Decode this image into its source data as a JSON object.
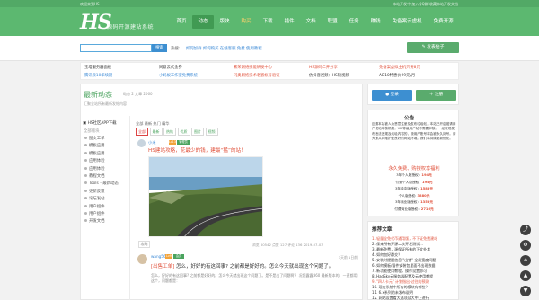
{
  "topbar": {
    "left": "欢迎来到HS",
    "right": "本站开发中 加入QQ群 收藏本站开发文档"
  },
  "header": {
    "logo": "HS",
    "logo_sub": "源码开源建站系统",
    "nav": [
      {
        "label": "首页",
        "active": false,
        "hot": false
      },
      {
        "label": "动态",
        "active": true,
        "hot": false
      },
      {
        "label": "版块",
        "active": false,
        "hot": false
      },
      {
        "label": "购买",
        "active": false,
        "hot": true
      },
      {
        "label": "下载",
        "active": false,
        "hot": false
      },
      {
        "label": "插件",
        "active": false,
        "hot": false
      },
      {
        "label": "文档",
        "active": false,
        "hot": false
      },
      {
        "label": "联盟",
        "active": false,
        "hot": false
      },
      {
        "label": "任务",
        "active": false,
        "hot": false
      },
      {
        "label": "赚钱",
        "active": false,
        "hot": false
      },
      {
        "label": "免备案云虚机",
        "active": false,
        "hot": false
      },
      {
        "label": "免费开源",
        "active": false,
        "hot": false
      }
    ]
  },
  "search": {
    "placeholder": "",
    "button": "搜索",
    "hot_label": "热搜:",
    "hot_links": "如何加群 如何购买 在线客服 免费 使用教程"
  },
  "post_button": "发表帖子",
  "adlinks": [
    {
      "text": "宝塔服务器面板",
      "color": "#333333"
    },
    {
      "text": "同意云代金券",
      "color": "#333333"
    },
    {
      "text": "繁荣网络技能研发中心",
      "color": "#e0523c"
    },
    {
      "text": "HS源码二开分享",
      "color": "#e0523c"
    },
    {
      "text": "免备案虚拟主机只要8元",
      "color": "#e0523c"
    },
    {
      "text": "腾讯云10年续期",
      "color": "#3c8ad6"
    },
    {
      "text": "小蚂蚁工作室免费系统",
      "color": "#3c8ad6"
    },
    {
      "text": "闪奥网络技术老板帐号验证",
      "color": "#e0523c"
    },
    {
      "text": "仿抖音视频：HS短视频",
      "color": "#333333"
    },
    {
      "text": "AD10特惠价99元/月",
      "color": "#333333"
    }
  ],
  "main": {
    "title": "最新动态",
    "meta": "动态 2   文章 2060",
    "desc": "汇聚全站所有最新发帖内容",
    "app_download": "HS社区APP下载",
    "menu_head": "全部版块",
    "menu": [
      "图文工单",
      "模板应用",
      "模板应用",
      "应用体验",
      "应用体验",
      "教程文档",
      "Tools - 最新动态",
      "更新反馈",
      "论坛发帖",
      "用户组件",
      "用户组件",
      "开发文档"
    ],
    "sort": "全部   最新   热门   精华",
    "tabs": [
      "全部",
      "最新",
      "热帖",
      "优质",
      "图片",
      "视频"
    ],
    "post1": {
      "user": "小米",
      "badge": "Lv13",
      "badge2": "管理员",
      "title": "HS建站攻略，花最少的钱，建最“猛”的站！",
      "tag": "攻略",
      "stats": "浏览 60542  点赞 127  评论 136  2019-07-03"
    },
    "post2": {
      "user": "wang5689",
      "badge": "Lv9",
      "badge2": "会员",
      "date": "3天前 1日前",
      "category": "[出售工单]",
      "title": "怎么，好好的有这回事?  之前都是好好的。怎么今天就出现这个问题了。",
      "body": "怎么，好好的有这回事?  之前都是好好的。怎么今天就出现这个问题了。是不是出了问题啊？ 况您露露360 最新版本的。一直都用这个，问题都是："
    }
  },
  "right": {
    "login": "登录",
    "register": "注册",
    "announce_title": "公告",
    "announce_body": "迈期本站被人为恶意注册及发布垃圾帖，本站已开启邀请用户发帖审核机制，VIP等级用户帖不需要审核。一经发现发布违法违规及垃圾内容的，使用户账号将会被永久封号。请大家共同维护此良好的网站环境。我们将持续更新优化。",
    "sub1": "永久免费、购授权享福利",
    "lines": [
      {
        "pre": "3年个人版授权：",
        "val": "194元"
      },
      {
        "pre": "付费个人版授权：",
        "val": "194元"
      },
      {
        "pre": "3年单中版授权：",
        "val": "1588元"
      },
      {
        "pre": "个人版授权: ",
        "val": "3880元"
      },
      {
        "pre": "3年商业版授权：",
        "val": "1358元"
      },
      {
        "pre": "付费商业版授权：",
        "val": "2716元"
      }
    ],
    "rec_title": "推荐文章",
    "rec": [
      "1. 轻量全免代币通用版，不下证免费建站",
      "2. 保来所有开源二次开发测试...",
      "3. 最新免费，源保证所有的下文外其",
      "4. 如何加好群交？",
      "5. 安装时提醒信息 \"出错\" 全局宽度问题",
      "6. 如何模板/插件安装包里面不出现数据",
      "7. 新功能使用教程，操作设置即可",
      "8. HadSky云服务器配置及云使用教程",
      "9. \"四人卡元\" 计划指出-过往的预测",
      "10. 现在系统中所有的模块有哪些？",
      "11. 6.x系列的未发布说明",
      "12. 网站设置看大选项及大中上进行"
    ]
  },
  "tools": [
    "share-icon",
    "gear-icon",
    "home-icon",
    "up-icon",
    "down-icon"
  ],
  "colors": {
    "brand": "#5cb870",
    "accent": "#e0523c",
    "link": "#3c8ad6"
  }
}
